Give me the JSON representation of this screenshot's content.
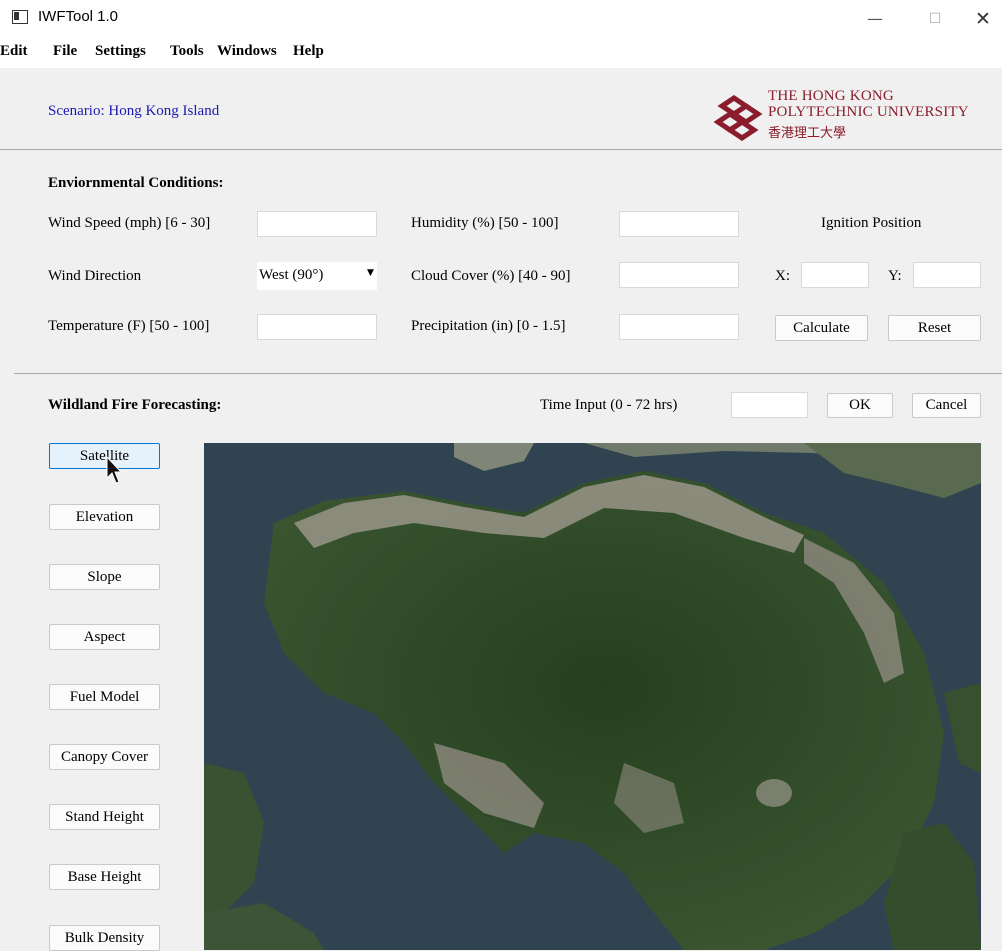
{
  "window": {
    "title": "IWFTool 1.0",
    "controls": {
      "minimize": "—",
      "maximize": "☐",
      "close": "✕"
    }
  },
  "menu": [
    "Edit",
    "File",
    "Settings",
    "Tools",
    "Windows",
    "Help"
  ],
  "header": {
    "scenario": "Scenario: Hong Kong Island",
    "logo_line1": "THE HONG KONG",
    "logo_line2": "POLYTECHNIC UNIVERSITY",
    "logo_line3": "香港理工大學",
    "logo_color": "#8a1c2b"
  },
  "env": {
    "heading": "Enviornmental Conditions:",
    "wind_speed_label": "Wind Speed (mph) [6 - 30]",
    "wind_speed_value": "",
    "wind_direction_label": "Wind Direction",
    "wind_direction_value": "West (90°)",
    "temperature_label": "Temperature (F) [50 - 100]",
    "temperature_value": "",
    "humidity_label": "Humidity (%) [50 - 100]",
    "humidity_value": "",
    "cloud_cover_label": "Cloud Cover (%) [40 - 90]",
    "cloud_cover_value": "",
    "precipitation_label": "Precipitation (in) [0 - 1.5]",
    "precipitation_value": "",
    "ignition_heading": "Ignition Position",
    "x_label": "X:",
    "x_value": "",
    "y_label": "Y:",
    "y_value": "",
    "calculate_label": "Calculate",
    "reset_label": "Reset"
  },
  "forecast": {
    "heading": "Wildland Fire Forecasting:",
    "time_label": "Time Input (0 - 72 hrs)",
    "time_value": "",
    "ok_label": "OK",
    "cancel_label": "Cancel"
  },
  "layers": [
    "Satellite",
    "Elevation",
    "Slope",
    "Aspect",
    "Fuel Model",
    "Canopy Cover",
    "Stand Height",
    "Base Height",
    "Bulk Density"
  ],
  "map": {
    "water_color": "#2f4450",
    "vegetation_color": "#2f4a2a",
    "urban_color": "#9a958a"
  }
}
